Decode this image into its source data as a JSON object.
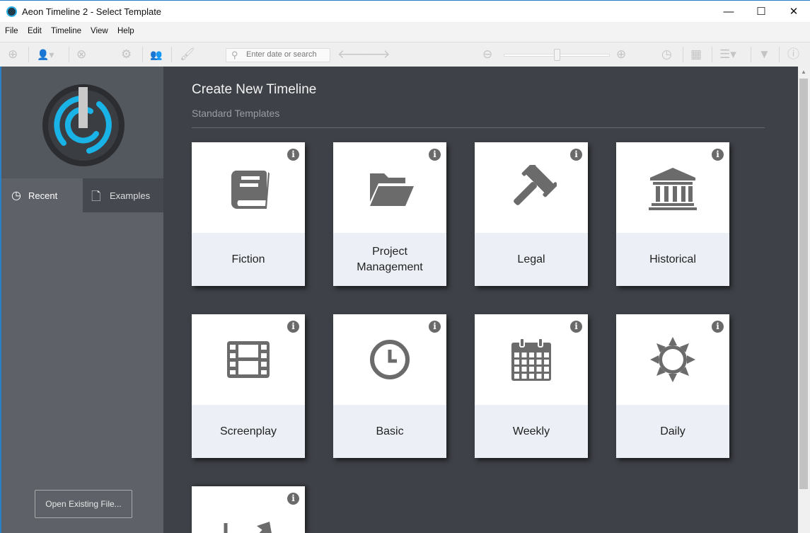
{
  "window": {
    "title": "Aeon Timeline 2 - Select Template",
    "controls": [
      "—",
      "☐",
      "✕"
    ]
  },
  "menu": [
    "File",
    "Edit",
    "Timeline",
    "View",
    "Help"
  ],
  "toolbar": {
    "search_placeholder": "Enter date or search",
    "zoom_level": 0.5
  },
  "sidebar": {
    "tabs": [
      {
        "label": "Recent",
        "icon": "clock-icon"
      },
      {
        "label": "Examples",
        "icon": "document-icon"
      }
    ],
    "open_button": "Open Existing File..."
  },
  "main": {
    "title": "Create New Timeline",
    "subtitle": "Standard Templates",
    "templates": [
      {
        "label": "Fiction",
        "icon": "book"
      },
      {
        "label": "Project Management",
        "icon": "folder"
      },
      {
        "label": "Legal",
        "icon": "gavel"
      },
      {
        "label": "Historical",
        "icon": "bank"
      },
      {
        "label": "Screenplay",
        "icon": "film"
      },
      {
        "label": "Basic",
        "icon": "clock"
      },
      {
        "label": "Weekly",
        "icon": "calendar"
      },
      {
        "label": "Daily",
        "icon": "sun"
      },
      {
        "label": "",
        "icon": "chart"
      }
    ],
    "info_glyph": "i"
  }
}
